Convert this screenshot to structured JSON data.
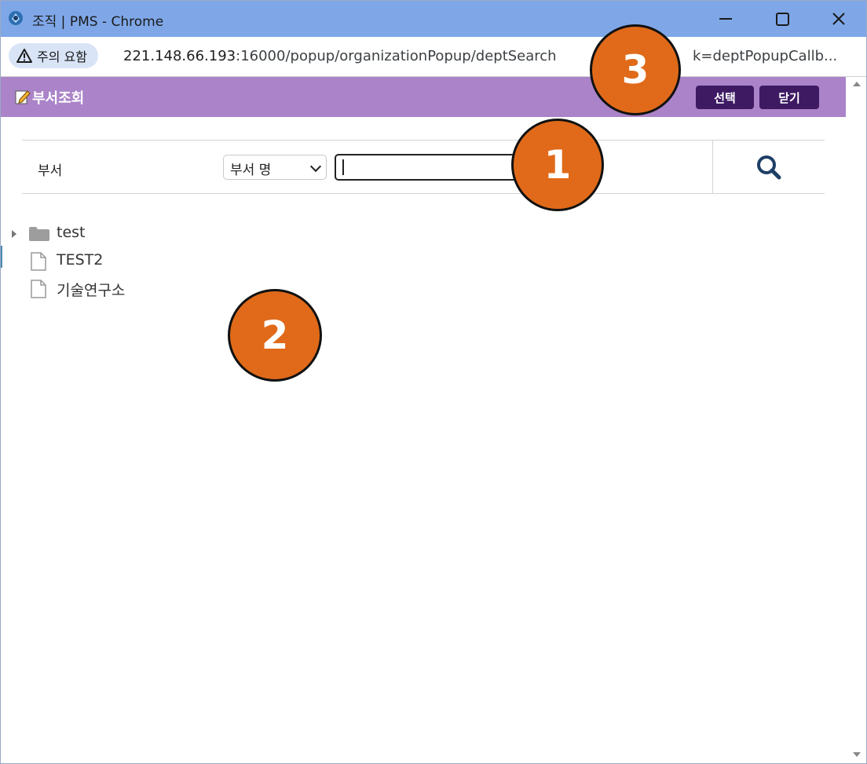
{
  "window": {
    "title": "조직 | PMS - Chrome",
    "controls": {
      "minimize": "minimize-icon",
      "maximize": "maximize-icon",
      "close": "close-icon"
    }
  },
  "address_bar": {
    "warning_label": "주의 요함",
    "url_host": "221.148.66.193",
    "url_rest": ":16000/popup/organizationPopup/deptSearch",
    "url_tail": "k=deptPopupCallb..."
  },
  "header": {
    "title": "부서조회",
    "select_button": "선택",
    "close_button": "닫기",
    "color": "#aa83c8",
    "button_color": "#3e1a63"
  },
  "search": {
    "label": "부서",
    "select_value": "부서 명",
    "input_value": "",
    "search_icon": "search-icon"
  },
  "tree": {
    "items": [
      {
        "label": "test",
        "type": "folder",
        "collapsed": true
      },
      {
        "label": "TEST2",
        "type": "file"
      },
      {
        "label": "기술연구소",
        "type": "file"
      }
    ]
  },
  "markers": [
    "1",
    "2",
    "3"
  ]
}
